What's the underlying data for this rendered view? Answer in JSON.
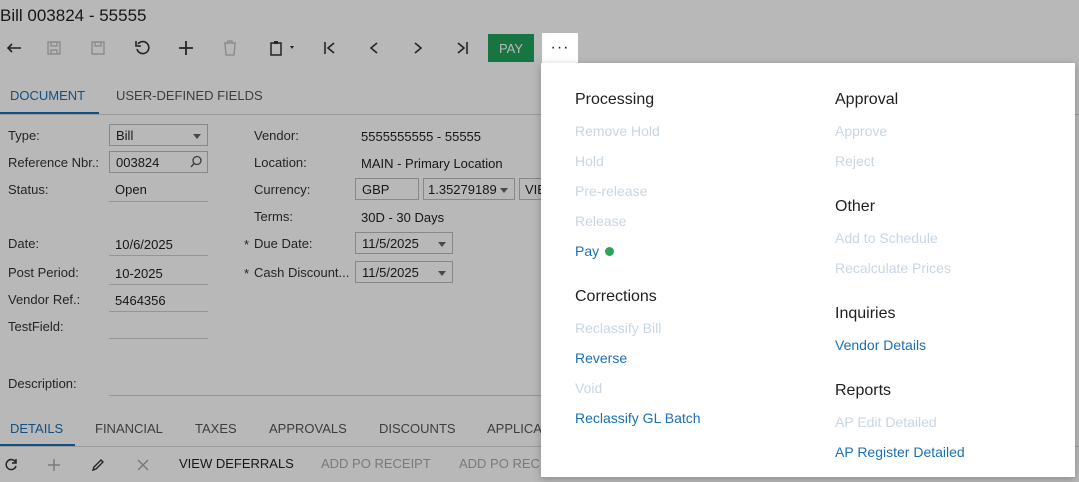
{
  "window": {
    "title": "Bill 003824 - 55555"
  },
  "toolbar": {
    "pay_label": "PAY",
    "more_label": "···",
    "icons": [
      "undo-back-icon",
      "save-icon",
      "save-close-icon",
      "cancel-icon",
      "add-icon",
      "delete-icon",
      "copy-paste-icon",
      "first-record-icon",
      "previous-record-icon",
      "next-record-icon",
      "last-record-icon"
    ]
  },
  "tabs_top": [
    {
      "label": "DOCUMENT"
    },
    {
      "label": "USER-DEFINED FIELDS"
    }
  ],
  "form": {
    "type": {
      "label": "Type:",
      "value": "Bill"
    },
    "ref": {
      "label": "Reference Nbr.:",
      "value": "003824"
    },
    "status": {
      "label": "Status:",
      "value": "Open"
    },
    "date": {
      "label": "Date:",
      "value": "10/6/2025"
    },
    "post_period": {
      "label": "Post Period:",
      "value": "10-2025"
    },
    "vendor_ref": {
      "label": "Vendor Ref.:",
      "value": "5464356"
    },
    "test_field": {
      "label": "TestField:",
      "value": ""
    },
    "description": {
      "label": "Description:",
      "value": ""
    },
    "vendor": {
      "label": "Vendor:",
      "value": "5555555555 - 55555"
    },
    "location": {
      "label": "Location:",
      "value": "MAIN - Primary Location"
    },
    "currency": {
      "label": "Currency:",
      "value": "GBP",
      "rate": "1.35279189",
      "extra": "VIE"
    },
    "terms": {
      "label": "Terms:",
      "value": "30D - 30 Days"
    },
    "due_date": {
      "label": "Due Date:",
      "value": "11/5/2025",
      "required_mark": "*"
    },
    "cash_discount": {
      "label": "Cash Discount...",
      "value": "11/5/2025",
      "required_mark": "*"
    }
  },
  "tabs_bottom": [
    {
      "label": "DETAILS"
    },
    {
      "label": "FINANCIAL"
    },
    {
      "label": "TAXES"
    },
    {
      "label": "APPROVALS"
    },
    {
      "label": "DISCOUNTS"
    },
    {
      "label": "APPLICA"
    }
  ],
  "grid_toolbar": {
    "view_deferrals": "VIEW DEFERRALS",
    "add_po_receipt": "ADD PO RECEIPT",
    "add_po_rec": "ADD PO REC"
  },
  "menu": {
    "processing": {
      "title": "Processing",
      "items": [
        "Remove Hold",
        "Hold",
        "Pre-release",
        "Release",
        "Pay"
      ]
    },
    "corrections": {
      "title": "Corrections",
      "items": [
        "Reclassify Bill",
        "Reverse",
        "Void",
        "Reclassify GL Batch"
      ]
    },
    "approval": {
      "title": "Approval",
      "items": [
        "Approve",
        "Reject"
      ]
    },
    "other": {
      "title": "Other",
      "items": [
        "Add to Schedule",
        "Recalculate Prices"
      ]
    },
    "inquiries": {
      "title": "Inquiries",
      "items": [
        "Vendor Details"
      ]
    },
    "reports": {
      "title": "Reports",
      "items": [
        "AP Edit Detailed",
        "AP Register Detailed"
      ]
    }
  },
  "colors": {
    "accent": "#1b6fb3",
    "pay_green": "#1fa35b",
    "disabled_item": "#c9d6e2"
  }
}
